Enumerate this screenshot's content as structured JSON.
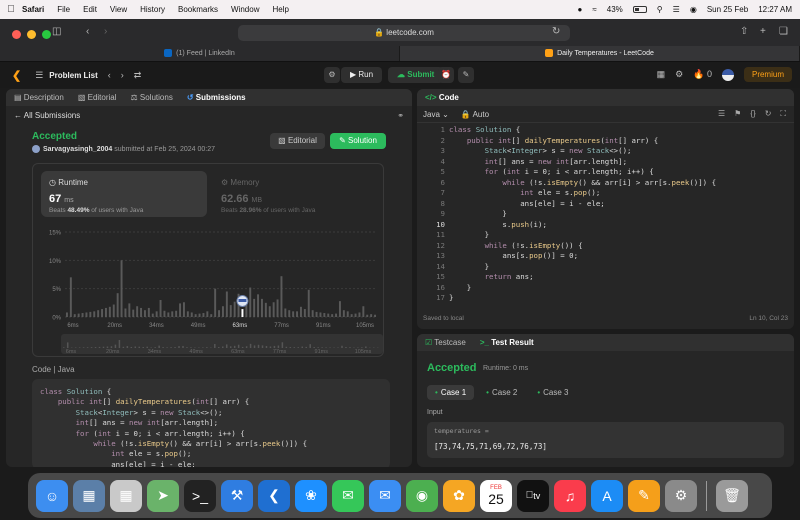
{
  "menubar": {
    "app": "Safari",
    "items": [
      "File",
      "Edit",
      "View",
      "History",
      "Bookmarks",
      "Window",
      "Help"
    ],
    "battery": "43%",
    "battery_level": 0.43,
    "date": "Sun 25 Feb",
    "time": "12:27 AM"
  },
  "browser": {
    "url": "leetcode.com",
    "tabs": [
      {
        "label": "(1) Feed | LinkedIn",
        "favicon": "linkedin-icon",
        "color": "#0a66c2"
      },
      {
        "label": "Daily Temperatures - LeetCode",
        "favicon": "leetcode-icon",
        "color": "#ffa116"
      }
    ]
  },
  "lc_header": {
    "problem_list": "Problem List",
    "run": "Run",
    "submit": "Submit",
    "streak": "0",
    "premium": "Premium"
  },
  "left_panel": {
    "tabs": [
      "Description",
      "Editorial",
      "Solutions",
      "Submissions"
    ],
    "active_tab": "Submissions",
    "all_submissions": "All Submissions",
    "status": "Accepted",
    "user": "Sarvagyasingh_2004",
    "submitted_text": "submitted at Feb 25, 2024 00:27",
    "editorial_btn": "Editorial",
    "solution_btn": "Solution",
    "runtime": {
      "title": "Runtime",
      "value": "67",
      "unit": "ms",
      "beats_prefix": "Beats",
      "beats_pct": "48.49%",
      "beats_suffix": "of users with Java"
    },
    "memory": {
      "title": "Memory",
      "value": "62.66",
      "unit": "MB",
      "beats_prefix": "Beats",
      "beats_pct": "28.96%",
      "beats_suffix": "of users with Java"
    },
    "code_label": "Code",
    "code_lang": "Java",
    "code_lines": [
      "class Solution {",
      "    public int[] dailyTemperatures(int[] arr) {",
      "        Stack<Integer> s = new Stack<>();",
      "        int[] ans = new int[arr.length];",
      "        for (int i = 0; i < arr.length; i++) {",
      "            while (!s.isEmpty() && arr[i] > arr[s.peek()]) {",
      "                int ele = s.pop();",
      "                ans[ele] = i - ele;"
    ]
  },
  "chart_data": {
    "type": "bar",
    "title": "",
    "xlabel": "",
    "ylabel": "",
    "y_ticks": [
      "15%",
      "10%",
      "5%",
      "0%"
    ],
    "ylim": [
      0,
      15
    ],
    "x_ticks": [
      "6ms",
      "20ms",
      "34ms",
      "49ms",
      "63ms",
      "77ms",
      "91ms",
      "105ms"
    ],
    "highlight_tick": "63ms",
    "values": [
      0.8,
      7,
      0.5,
      0.6,
      0.7,
      0.8,
      0.9,
      1.0,
      1.2,
      1.4,
      1.6,
      1.8,
      2.2,
      4.2,
      10,
      1.5,
      2.4,
      1.3,
      1.9,
      1.6,
      1.2,
      1.6,
      0.6,
      1.0,
      3,
      1.1,
      0.8,
      1.0,
      1.1,
      2.4,
      2.6,
      1.0,
      0.8,
      0.5,
      0.6,
      0.7,
      1.0,
      0.5,
      5,
      1.2,
      1.9,
      4.5,
      2.1,
      2.7,
      4.1,
      1.4,
      2.2,
      5.2,
      3.2,
      4.0,
      3.2,
      2.5,
      1.9,
      2.6,
      3.1,
      7.2,
      1.5,
      1.2,
      1.0,
      1.0,
      1.8,
      1.4,
      4.8,
      1.2,
      0.9,
      0.8,
      0.7,
      0.6,
      0.5,
      0.6,
      2.8,
      1.2,
      1.0,
      0.5,
      0.6,
      0.8,
      1.9,
      0.4,
      0.5,
      0.4
    ],
    "highlight_index": 45,
    "grid": true
  },
  "code_panel": {
    "title": "Code",
    "language": "Java",
    "mode": "Auto",
    "saved": "Saved to local",
    "cursor": "Ln 10, Col 23",
    "current_line": 10,
    "lines": [
      "class Solution {",
      "    public int[] dailyTemperatures(int[] arr) {",
      "        Stack<Integer> s = new Stack<>();",
      "        int[] ans = new int[arr.length];",
      "        for (int i = 0; i < arr.length; i++) {",
      "            while (!s.isEmpty() && arr[i] > arr[s.peek()]) {",
      "                int ele = s.pop();",
      "                ans[ele] = i - ele;",
      "            }",
      "            s.push(i);",
      "        }",
      "        while (!s.isEmpty()) {",
      "            ans[s.pop()] = 0;",
      "        }",
      "        return ans;",
      "    }",
      "}"
    ]
  },
  "result_panel": {
    "tabs": [
      "Testcase",
      "Test Result"
    ],
    "active_tab": "Test Result",
    "status": "Accepted",
    "runtime": "Runtime: 0 ms",
    "cases": [
      "Case 1",
      "Case 2",
      "Case 3"
    ],
    "active_case": "Case 1",
    "input_label": "Input",
    "input_name": "temperatures =",
    "input_value": "[73,74,75,71,69,72,76,73]"
  },
  "dock": {
    "apps": [
      {
        "name": "finder-icon",
        "color": "#3d8ef0"
      },
      {
        "name": "preview-icon",
        "color": "#5b7fa8"
      },
      {
        "name": "launchpad-icon",
        "color": "#c9c9c9"
      },
      {
        "name": "maps-icon",
        "color": "#6ab36a"
      },
      {
        "name": "terminal-icon",
        "color": "#222222"
      },
      {
        "name": "xcode-icon",
        "color": "#2f7de1"
      },
      {
        "name": "vscode-icon",
        "color": "#1f6fd1"
      },
      {
        "name": "safari-icon",
        "color": "#1e90ff"
      },
      {
        "name": "messages-icon",
        "color": "#35c759"
      },
      {
        "name": "mail-icon",
        "color": "#3b8ef3"
      },
      {
        "name": "chrome-icon",
        "color": "#4caf50"
      },
      {
        "name": "photos-icon",
        "color": "#f5a623"
      },
      {
        "name": "calendar-icon",
        "color": "#ffffff"
      },
      {
        "name": "appletv-icon",
        "color": "#111111"
      },
      {
        "name": "music-icon",
        "color": "#fa3c4c"
      },
      {
        "name": "appstore-icon",
        "color": "#1c8cf5"
      },
      {
        "name": "pages-icon",
        "color": "#f59f1a"
      },
      {
        "name": "settings-icon",
        "color": "#8a8a8a"
      },
      {
        "name": "trash-icon",
        "color": "#9a9a9a"
      }
    ],
    "calendar_month": "FEB",
    "calendar_day": "25",
    "appletv_label": "tv"
  }
}
